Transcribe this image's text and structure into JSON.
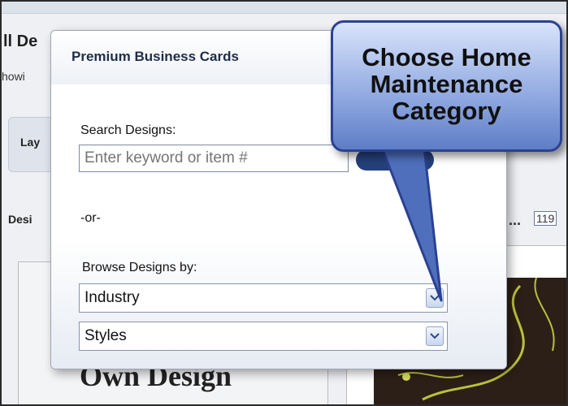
{
  "background": {
    "title_fragment": "ll De",
    "showing_fragment": "howi",
    "tab_fragment": "Lay",
    "design_fragment": "Desi",
    "pagination_ellipsis": "...",
    "pagination_number": "119",
    "heading_fragment": "Own Design"
  },
  "dialog": {
    "title": "Premium Business Cards",
    "search_label": "Search Designs:",
    "search_placeholder": "Enter keyword or item #",
    "or_text": "-or-",
    "browse_label": "Browse Designs by:",
    "selects": [
      {
        "value": "Industry"
      },
      {
        "value": "Styles"
      }
    ]
  },
  "callout": {
    "lines": [
      "Choose Home",
      "Maintenance",
      "Category"
    ]
  },
  "colors": {
    "dialog_title": "#1f2d4a",
    "callout_fill": "#8ea7e0",
    "callout_border": "#2b4191",
    "search_button": "#24407a"
  },
  "icons": {
    "select_arrow": "chevron-down-icon"
  }
}
